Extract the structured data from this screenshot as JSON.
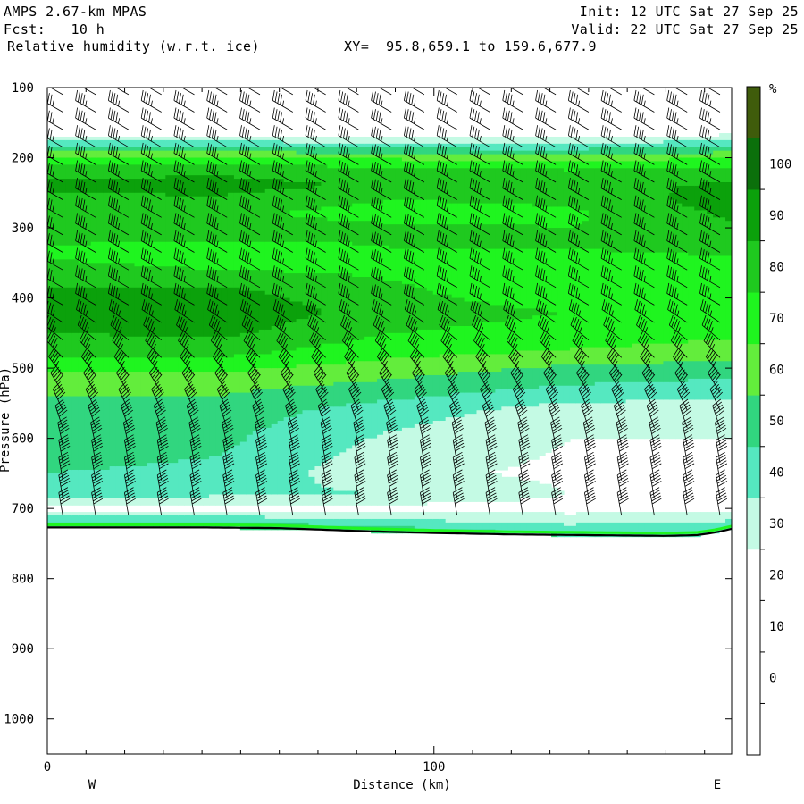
{
  "header": {
    "model": "AMPS 2.67-km MPAS",
    "fcst": "Fcst:   10 h",
    "field": "Relative humidity (w.r.t. ice)",
    "xy": "XY=  95.8,659.1 to 159.6,677.9",
    "init": "Init: 12 UTC Sat 27 Sep 25",
    "valid": "Valid: 22 UTC Sat 27 Sep 25"
  },
  "chart_data": {
    "type": "heatmap",
    "title": "Relative humidity (w.r.t. ice)",
    "xlabel": "Distance (km)",
    "ylabel": "Pressure (hPa)",
    "xlim": [
      0,
      177
    ],
    "ylim": [
      1050,
      100
    ],
    "xticks": [
      0,
      100
    ],
    "yticks": [
      100,
      200,
      300,
      400,
      500,
      600,
      700,
      800,
      900,
      1000
    ],
    "left_end_label": "W",
    "right_end_label": "E",
    "colorbar": {
      "unit": "%",
      "levels": [
        -10,
        0,
        10,
        20,
        30,
        40,
        50,
        60,
        70,
        80,
        90,
        100,
        110
      ],
      "tick_labels": [
        0,
        10,
        20,
        30,
        40,
        50,
        60,
        70,
        80,
        90,
        100
      ],
      "colors": [
        "#ffffff",
        "#ffffff",
        "#ffffff",
        "#ffffff",
        "#c4fae4",
        "#55e8c0",
        "#31d67f",
        "#63ed3c",
        "#1ff51f",
        "#1fc91f",
        "#0ba10b",
        "#0b700b",
        "#3f5c0b"
      ]
    },
    "terrain_pressure": [
      {
        "x": 0,
        "p": 727
      },
      {
        "x": 20,
        "p": 727
      },
      {
        "x": 40,
        "p": 727
      },
      {
        "x": 60,
        "p": 728
      },
      {
        "x": 80,
        "p": 732
      },
      {
        "x": 100,
        "p": 735
      },
      {
        "x": 120,
        "p": 737
      },
      {
        "x": 140,
        "p": 738
      },
      {
        "x": 160,
        "p": 739
      },
      {
        "x": 168,
        "p": 738
      },
      {
        "x": 173,
        "p": 734
      },
      {
        "x": 177,
        "p": 729
      }
    ],
    "rh_profiles": [
      {
        "x": 0,
        "p": [
          100,
          150,
          180,
          200,
          220,
          240,
          260,
          280,
          300,
          330,
          360,
          390,
          420,
          450,
          480,
          500,
          530,
          560,
          600,
          650,
          680,
          700,
          727
        ],
        "rh": [
          -5,
          5,
          45,
          70,
          88,
          92,
          88,
          84,
          88,
          78,
          82,
          92,
          100,
          90,
          82,
          72,
          62,
          55,
          55,
          50,
          44,
          25,
          60
        ]
      },
      {
        "x": 45,
        "p": [
          100,
          150,
          180,
          200,
          220,
          240,
          260,
          280,
          300,
          330,
          360,
          390,
          420,
          450,
          480,
          500,
          530,
          560,
          600,
          650,
          680,
          700,
          727
        ],
        "rh": [
          -5,
          5,
          45,
          72,
          88,
          94,
          88,
          82,
          86,
          76,
          80,
          92,
          98,
          92,
          82,
          72,
          62,
          55,
          52,
          48,
          42,
          25,
          60
        ]
      },
      {
        "x": 90,
        "p": [
          100,
          150,
          180,
          200,
          220,
          240,
          260,
          280,
          300,
          330,
          360,
          390,
          420,
          450,
          480,
          500,
          530,
          560,
          600,
          650,
          680,
          700,
          732
        ],
        "rh": [
          -5,
          5,
          40,
          68,
          85,
          88,
          80,
          75,
          82,
          80,
          78,
          82,
          85,
          80,
          72,
          65,
          55,
          45,
          38,
          32,
          40,
          25,
          55
        ]
      },
      {
        "x": 135,
        "p": [
          100,
          150,
          180,
          200,
          220,
          240,
          260,
          280,
          300,
          330,
          360,
          390,
          420,
          450,
          480,
          500,
          530,
          560,
          600,
          650,
          680,
          700,
          738
        ],
        "rh": [
          -5,
          5,
          40,
          65,
          82,
          86,
          82,
          78,
          80,
          80,
          75,
          72,
          80,
          76,
          68,
          58,
          48,
          35,
          30,
          28,
          30,
          25,
          50
        ]
      },
      {
        "x": 177,
        "p": [
          100,
          150,
          180,
          200,
          220,
          240,
          260,
          280,
          300,
          330,
          360,
          390,
          420,
          450,
          480,
          500,
          530,
          560,
          600,
          650,
          680,
          700,
          729
        ],
        "rh": [
          -5,
          10,
          45,
          70,
          85,
          92,
          95,
          92,
          88,
          82,
          76,
          72,
          78,
          72,
          65,
          55,
          45,
          35,
          30,
          28,
          30,
          25,
          50
        ]
      }
    ],
    "wind_barbs": {
      "columns_x": [
        4,
        12.5,
        21,
        29.5,
        38,
        46.5,
        55,
        63.5,
        72,
        80.5,
        89,
        97.5,
        106,
        114.5,
        123,
        131.5,
        140,
        148.5,
        157,
        165.5,
        174
      ],
      "levels_p": [
        110,
        135,
        160,
        185,
        210,
        235,
        260,
        285,
        310,
        335,
        360,
        385,
        410,
        435,
        460,
        485,
        510,
        535,
        560,
        585,
        610,
        635,
        660,
        685,
        710
      ],
      "upper_dir_deg": 300,
      "upper_speed_kt": 45,
      "lower_dir_deg": 350,
      "lower_speed_kt": 50
    }
  }
}
